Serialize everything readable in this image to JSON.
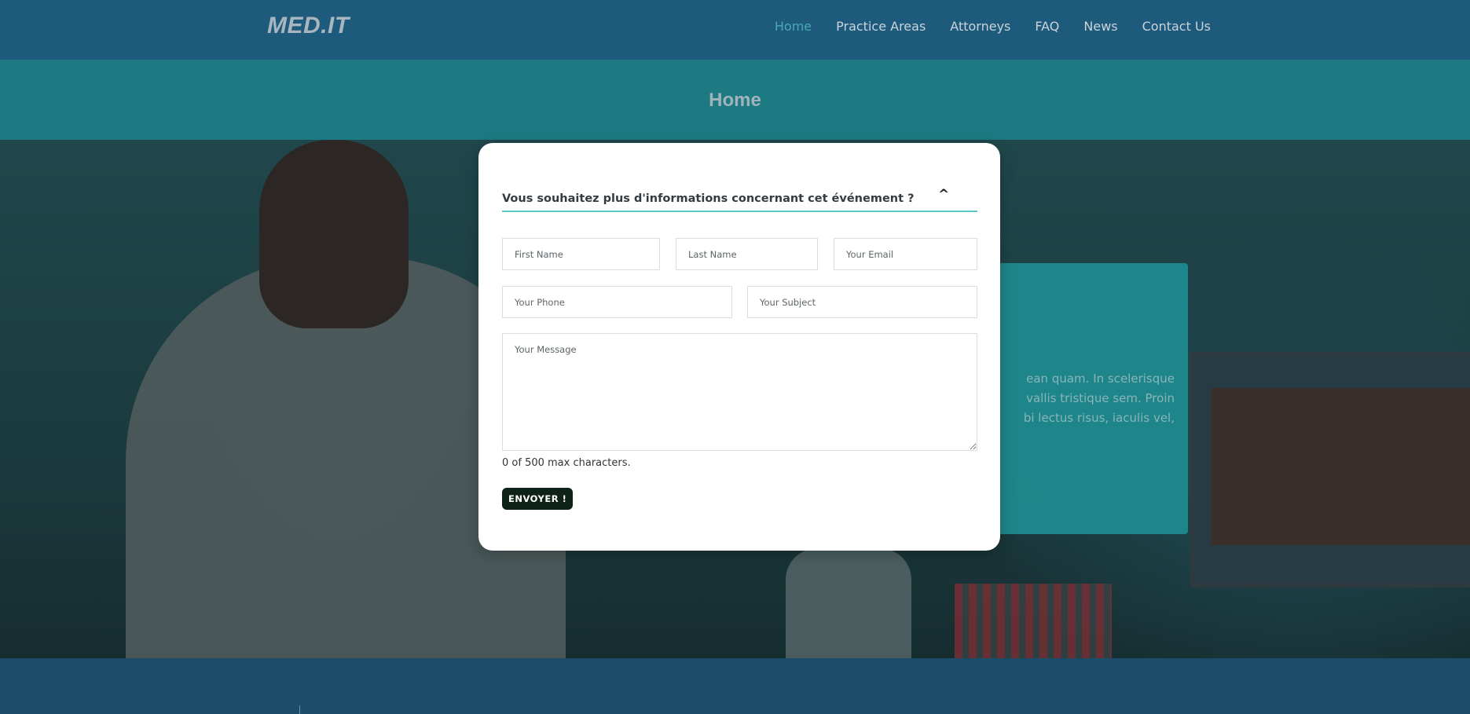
{
  "header": {
    "logo": "MED.IT",
    "nav": [
      {
        "label": "Home",
        "active": true
      },
      {
        "label": "Practice Areas"
      },
      {
        "label": "Attorneys"
      },
      {
        "label": "FAQ"
      },
      {
        "label": "News"
      },
      {
        "label": "Contact Us"
      }
    ]
  },
  "page": {
    "title": "Home"
  },
  "hero": {
    "card_lines": [
      "ean quam. In scelerisque",
      "vallis tristique sem. Proin",
      "bi lectus risus, iaculis vel,"
    ]
  },
  "modal": {
    "title": "Vous souhaitez plus d'informations concernant cet événement ?",
    "collapse_icon": "^",
    "fields": {
      "first_name": "First Name",
      "last_name": "Last Name",
      "email": "Your Email",
      "phone": "Your Phone",
      "subject": "Your Subject",
      "message": "Your Message"
    },
    "counter": "0 of 500 max characters.",
    "submit_label": "ENVOYER !"
  },
  "colors": {
    "header_bg": "#1d5a7b",
    "title_band": "#1d7a82",
    "accent": "#5ec8c9",
    "nav_active": "#4aa9b5",
    "button_bg": "#0f2218"
  }
}
